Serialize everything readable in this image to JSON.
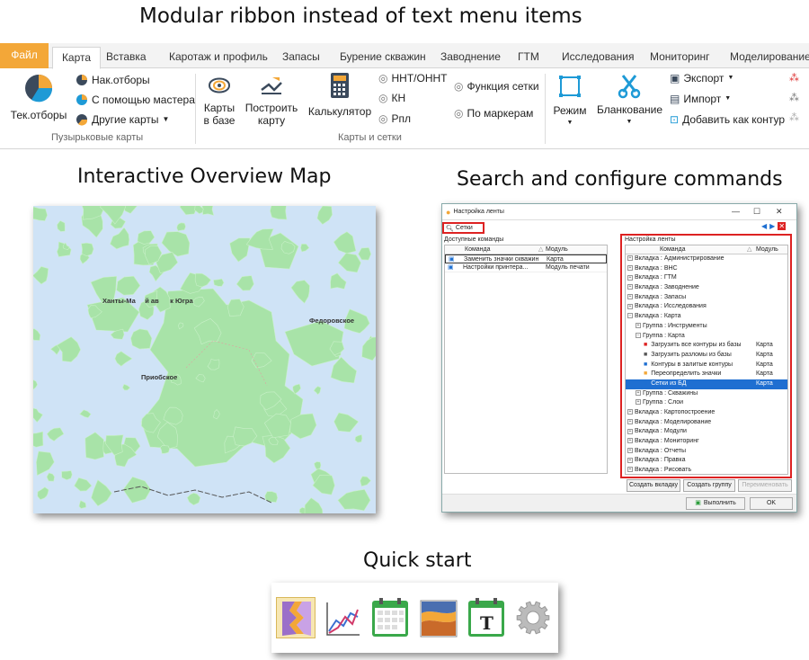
{
  "headings": {
    "ribbon": "Modular ribbon instead of text menu items",
    "map": "Interactive Overview Map",
    "search": "Search and configure commands",
    "quickstart": "Quick start"
  },
  "ribbon": {
    "tabs": [
      "Файл",
      "Карта",
      "Вставка",
      "Каротаж и профиль",
      "Запасы",
      "Бурение скважин",
      "Заводнение",
      "ГТМ",
      "Исследования",
      "Мониторинг",
      "Моделирование"
    ],
    "active_tab": "Карта",
    "buttons": {
      "tek_otbory": "Тек.отборы",
      "nak_otbory": "Нак.отборы",
      "master": "С помощью мастера",
      "other_maps": "Другие карты",
      "maps_in_db": "Карты\nв базе",
      "build_map": "Построить\nкарту",
      "calculator": "Калькулятор",
      "nnt": "ННТ/ОННТ",
      "kn": "КН",
      "rpl": "Рпл",
      "grid_func": "Функция сетки",
      "by_markers": "По маркерам",
      "mode": "Режим",
      "blanking": "Бланкование",
      "export": "Экспорт",
      "import": "Импорт",
      "add_contour": "Добавить как контур"
    },
    "groups": {
      "bubble": "Пузырьковые карты",
      "maps_grids": "Карты и сетки"
    },
    "colors": {
      "file_tab": "#f3a738",
      "accent": "#1f6fd1"
    }
  },
  "map": {
    "labels": {
      "khanty": "Ханты-Ма     й ав      к Югра",
      "fedorov": "Федоровское",
      "priob": "Приобское"
    },
    "colors": {
      "water": "#cfe3f6",
      "land": "#a8e3a8"
    }
  },
  "dialog": {
    "title": "Настройка ленты",
    "search_value": "Сетки",
    "left_header": "Доступные команды",
    "right_header": "Настройка ленты",
    "col_command": "Команда",
    "col_module": "Модуль",
    "left_rows": [
      {
        "cmd": "Заменить значки скважин",
        "mod": "Карта"
      },
      {
        "cmd": "Настройки принтера...",
        "mod": "Модуль печати"
      }
    ],
    "tree": [
      {
        "level": 0,
        "text": "Вкладка : Администрирование",
        "mod": "",
        "type": "plus"
      },
      {
        "level": 0,
        "text": "Вкладка : ВНС",
        "mod": "",
        "type": "plus"
      },
      {
        "level": 0,
        "text": "Вкладка : ГТМ",
        "mod": "",
        "type": "plus"
      },
      {
        "level": 0,
        "text": "Вкладка : Заводнение",
        "mod": "",
        "type": "plus"
      },
      {
        "level": 0,
        "text": "Вкладка : Запасы",
        "mod": "",
        "type": "plus"
      },
      {
        "level": 0,
        "text": "Вкладка : Исследования",
        "mod": "",
        "type": "plus"
      },
      {
        "level": 0,
        "text": "Вкладка : Карта",
        "mod": "",
        "type": "minus"
      },
      {
        "level": 1,
        "text": "Группа : Инструменты",
        "mod": "",
        "type": "plus"
      },
      {
        "level": 1,
        "text": "Группа : Карта",
        "mod": "",
        "type": "minus"
      },
      {
        "level": 2,
        "text": "Загрузить все контуры из базы",
        "mod": "Карта",
        "type": "icon"
      },
      {
        "level": 2,
        "text": "Загрузить разломы из базы",
        "mod": "Карта",
        "type": "icon"
      },
      {
        "level": 2,
        "text": "Контуры в залитые контуры",
        "mod": "Карта",
        "type": "icon"
      },
      {
        "level": 2,
        "text": "Переопределить значки",
        "mod": "Карта",
        "type": "icon"
      },
      {
        "level": 2,
        "text": "Сетки из БД",
        "mod": "Карта",
        "type": "icon",
        "selected": true
      },
      {
        "level": 1,
        "text": "Группа : Скважины",
        "mod": "",
        "type": "plus"
      },
      {
        "level": 1,
        "text": "Группа : Слои",
        "mod": "",
        "type": "plus"
      },
      {
        "level": 0,
        "text": "Вкладка : Картопостроение",
        "mod": "",
        "type": "plus"
      },
      {
        "level": 0,
        "text": "Вкладка : Моделирование",
        "mod": "",
        "type": "plus"
      },
      {
        "level": 0,
        "text": "Вкладка : Модули",
        "mod": "",
        "type": "plus"
      },
      {
        "level": 0,
        "text": "Вкладка : Мониторинг",
        "mod": "",
        "type": "plus"
      },
      {
        "level": 0,
        "text": "Вкладка : Отчеты",
        "mod": "",
        "type": "plus"
      },
      {
        "level": 0,
        "text": "Вкладка : Правка",
        "mod": "",
        "type": "plus"
      },
      {
        "level": 0,
        "text": "Вкладка : Рисовать",
        "mod": "",
        "type": "plus"
      }
    ],
    "buttons": {
      "create_tab": "Создать вкладку",
      "create_group": "Создать группу",
      "rename": "Переименовать",
      "run": "Выполнить",
      "ok": "OK"
    }
  },
  "quickstart": {
    "icons": [
      "layers-icon",
      "chart-icon",
      "calendar-icon",
      "section-icon",
      "text-calendar-icon",
      "gear-icon"
    ],
    "text_icon_glyph": "T"
  }
}
